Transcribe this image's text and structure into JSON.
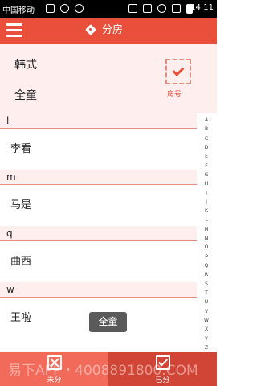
{
  "status_bar": {
    "carrier": "中国移动",
    "time": "14:11"
  },
  "header": {
    "title": "分房"
  },
  "filters": {
    "options": [
      "韩式",
      "全童"
    ],
    "room_label": "房号"
  },
  "sections": [
    {
      "letter": "l",
      "contacts": [
        "李看"
      ]
    },
    {
      "letter": "m",
      "contacts": [
        "马是"
      ]
    },
    {
      "letter": "q",
      "contacts": [
        "曲西"
      ]
    },
    {
      "letter": "w",
      "contacts": [
        "王啦"
      ]
    }
  ],
  "index_letters": [
    "A",
    "B",
    "C",
    "D",
    "E",
    "F",
    "G",
    "H",
    "I",
    "J",
    "K",
    "L",
    "M",
    "N",
    "O",
    "P",
    "Q",
    "R",
    "S",
    "T",
    "U",
    "V",
    "W",
    "X",
    "Y",
    "Z"
  ],
  "toast": "全童",
  "bottom_tabs": {
    "unassigned": "未分",
    "assigned": "已分"
  },
  "watermark": "易下APP・4008891800.COM",
  "colors": {
    "accent": "#e94f3a",
    "section_bg": "#ffeeee",
    "tab_unassigned": "#f16a5a",
    "tab_assigned": "#d04535"
  },
  "icons": {
    "menu": "menu-icon",
    "title": "tag-icon",
    "room_check": "checkbox-checked-icon",
    "unassigned": "checkbox-x-icon",
    "assigned": "checkbox-checked-icon"
  }
}
